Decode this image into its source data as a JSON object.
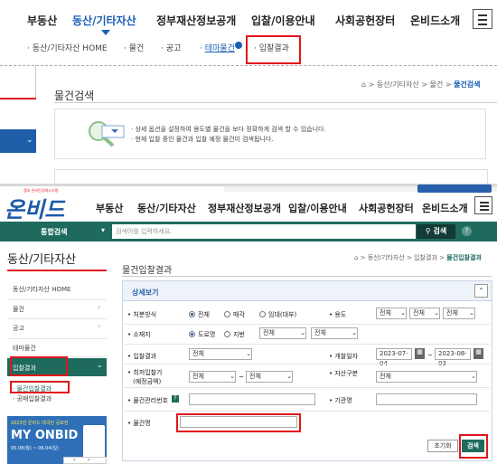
{
  "top": {
    "menu": [
      "부동산",
      "동산/기타자산",
      "정부재산정보공개",
      "입찰/이용안내",
      "사회공헌장터",
      "온비드소개"
    ],
    "submenu": [
      "동산/기타자산 HOME",
      "물건",
      "공고",
      "테마물건",
      "입찰결과"
    ],
    "page_title": "물건검색",
    "breadcrumb": [
      "동산/기타자산",
      "물건",
      "물건검색"
    ],
    "info_lines": [
      "상세 옵션을 설정하여 용도별 물건을 보다 정확하게 검색 할 수 있습니다.",
      "현재 입찰 중인 물건과 입찰 예정 물건이 검색됩니다."
    ]
  },
  "site": {
    "logo": "온비드",
    "logo_tag": "캠코 온라인공매시스템",
    "menu": [
      "부동산",
      "동산/기타자산",
      "정부재산정보공개",
      "입찰/이용안내",
      "사회공헌장터",
      "온비드소개"
    ],
    "search_scope": "통합검색",
    "search_placeholder": "검색어를 입력하세요.",
    "search_button": "검색"
  },
  "sidebar": {
    "title": "동산/기타자산",
    "items": [
      "동산/기타자산 HOME",
      "물건",
      "공고",
      "테마물건",
      "입찰결과"
    ],
    "subitems": [
      "물건입찰결과",
      "공매입찰결과"
    ],
    "banner_lines": [
      "2023년 온비드 대국민 공모전",
      "MY ONBID",
      "05.08(월) ~ 06.04(일)"
    ]
  },
  "main": {
    "title": "물건입찰결과",
    "breadcrumb": [
      "동산/기타자산",
      "입찰결과",
      "물건입찰결과"
    ],
    "detail_toggle": "상세보기",
    "labels": {
      "disposal": "처분방식",
      "usage": "용도",
      "location": "소재지",
      "result": "입찰결과",
      "opening_date": "개찰일자",
      "min_price": "최저입찰가",
      "min_price_sub": "(예정금액)",
      "asset_type": "자산구분",
      "mgmt_no": "물건관리번호",
      "agency": "기관명",
      "item_name": "물건명"
    },
    "disposal_options": [
      "전체",
      "매각",
      "임대(대부)"
    ],
    "location_options": [
      "도로명",
      "지번"
    ],
    "select_all": "전체",
    "date_from": "2023-07-04",
    "date_to": "2023-08-03",
    "reset_button": "초기화",
    "search_button": "검색"
  }
}
